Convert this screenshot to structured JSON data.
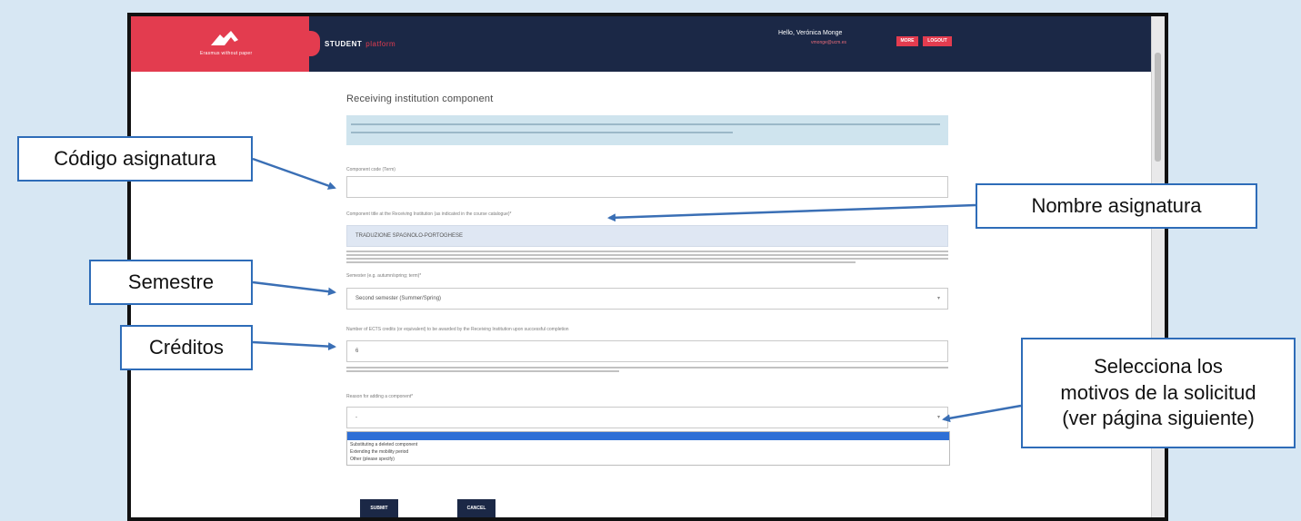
{
  "header": {
    "logo_subtitle": "Erasmus without paper",
    "app_title_main": "STUDENT",
    "app_title_accent": "platform",
    "greeting": "Hello, Verónica Monge",
    "user_email": "vmonge@ucm.es",
    "button_1": "MORE",
    "button_2": "LOGOUT"
  },
  "form": {
    "page_title": "Receiving institution component",
    "field_code_label": "Component code (Term)",
    "field_code_value": "",
    "field_title_label": "Component title at the Receiving Institution (as indicated in the course catalogue)*",
    "field_title_value": "TRADUZIONE SPAGNOLO-PORTOGHESE",
    "field_semester_label": "Semester (e.g. autumn/spring; term)*",
    "field_semester_value": "Second semester (Summer/Spring)",
    "field_credits_label": "Number of ECTS credits (or equivalent) to be awarded by the Receiving Institution upon successful completion",
    "field_credits_value": "6",
    "field_reason_label": "Reason for adding a component*",
    "field_reason_value": "-",
    "reason_options": [
      "Substituting a deleted component",
      "Extending the mobility period",
      "Other (please specify)"
    ],
    "submit_label": "SUBMIT",
    "cancel_label": "CANCEL"
  },
  "callouts": {
    "codigo": "Código asignatura",
    "nombre": "Nombre asignatura",
    "semestre": "Semestre",
    "creditos": "Créditos",
    "motivos_1": "Selecciona los",
    "motivos_2": "motivos de la solicitud",
    "motivos_3": "(ver página siguiente)"
  },
  "colors": {
    "header_navy": "#1b2846",
    "brand_red": "#e33c4f",
    "callout_border": "#2e6cb8",
    "info_box": "#cfe4ee",
    "background": "#d7e7f3"
  }
}
